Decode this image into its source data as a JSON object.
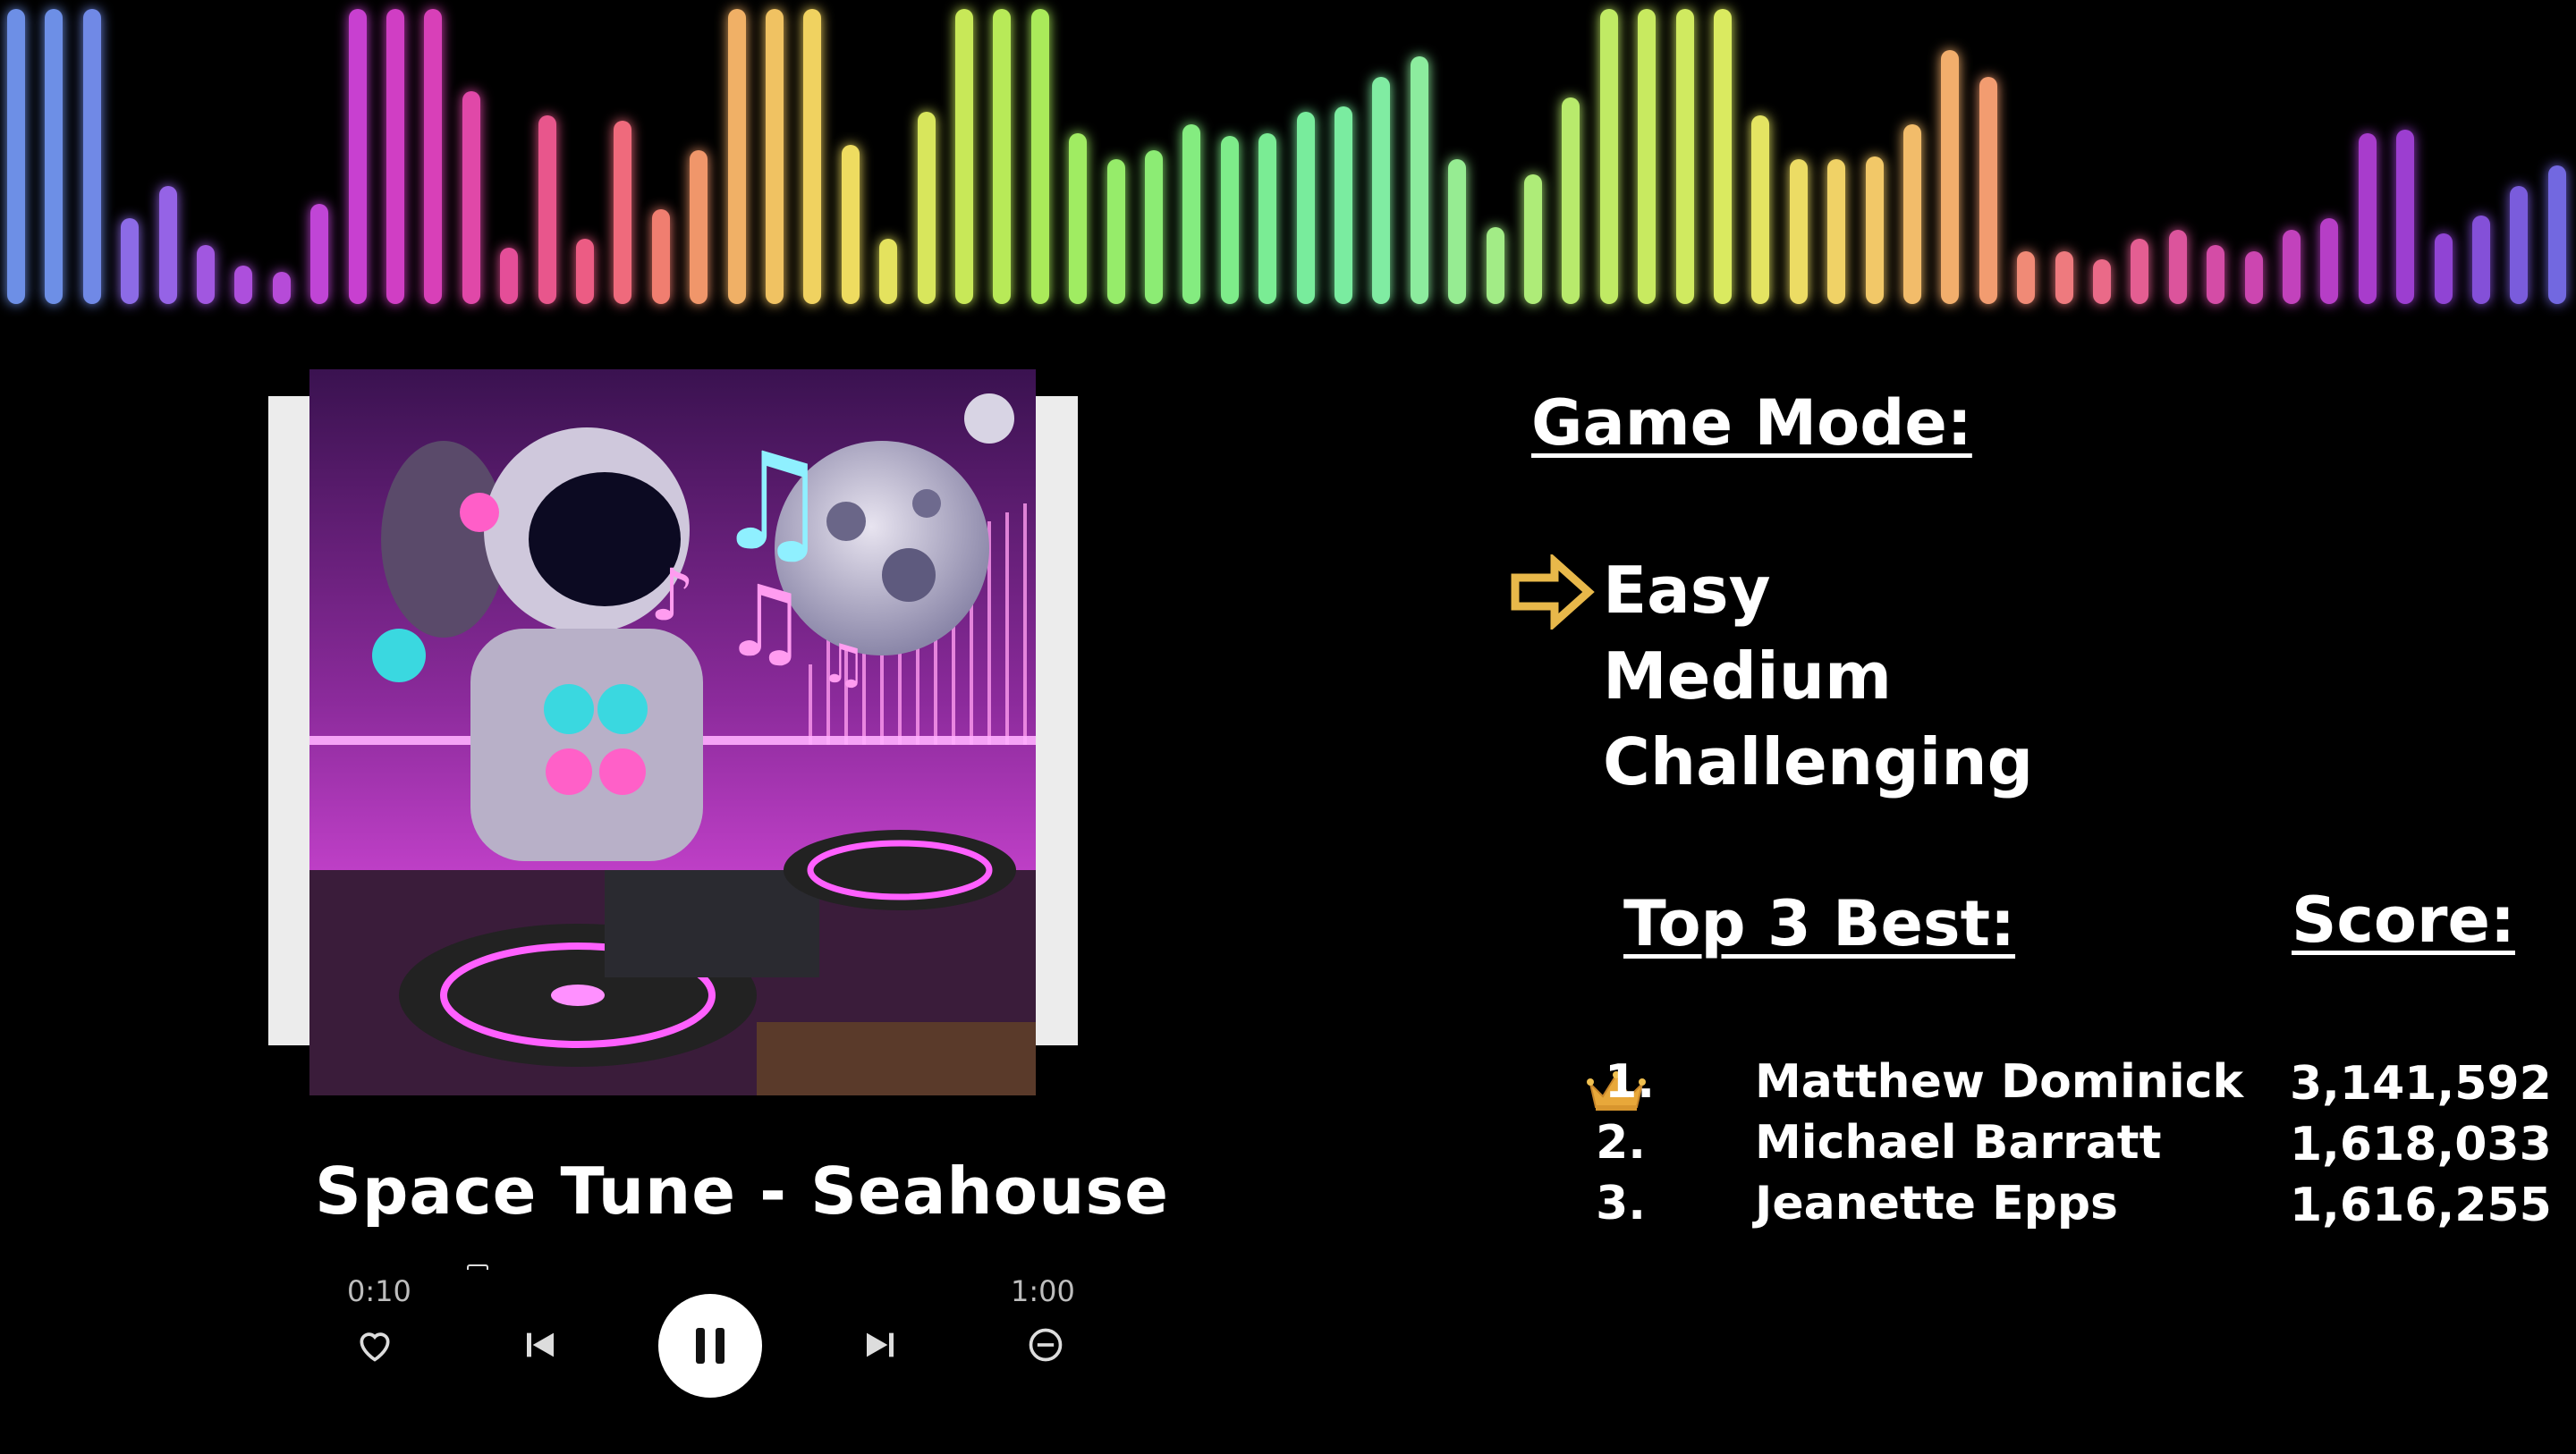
{
  "visualizer": {
    "bars": [
      {
        "level": 1.0,
        "color": "#6d8fe6"
      },
      {
        "level": 1.0,
        "color": "#6d8fe6"
      },
      {
        "level": 1.0,
        "color": "#7089e6"
      },
      {
        "level": 0.29,
        "color": "#8c6be6"
      },
      {
        "level": 0.4,
        "color": "#9563e6"
      },
      {
        "level": 0.2,
        "color": "#a157e0"
      },
      {
        "level": 0.13,
        "color": "#ad4fdc"
      },
      {
        "level": 0.11,
        "color": "#b64bd8"
      },
      {
        "level": 0.34,
        "color": "#c045d6"
      },
      {
        "level": 1.0,
        "color": "#c840d0"
      },
      {
        "level": 1.0,
        "color": "#d03ec4"
      },
      {
        "level": 1.0,
        "color": "#d840b8"
      },
      {
        "level": 0.72,
        "color": "#e048a8"
      },
      {
        "level": 0.19,
        "color": "#e44e98"
      },
      {
        "level": 0.64,
        "color": "#e8568c"
      },
      {
        "level": 0.22,
        "color": "#ec5c84"
      },
      {
        "level": 0.62,
        "color": "#ef6a7c"
      },
      {
        "level": 0.32,
        "color": "#f07e70"
      },
      {
        "level": 0.52,
        "color": "#f0966a"
      },
      {
        "level": 1.0,
        "color": "#f0b066"
      },
      {
        "level": 1.0,
        "color": "#f0c262"
      },
      {
        "level": 1.0,
        "color": "#f0d260"
      },
      {
        "level": 0.54,
        "color": "#eedc60"
      },
      {
        "level": 0.22,
        "color": "#e4e25e"
      },
      {
        "level": 0.65,
        "color": "#d8e65c"
      },
      {
        "level": 1.0,
        "color": "#c8e858"
      },
      {
        "level": 1.0,
        "color": "#b8ea58"
      },
      {
        "level": 1.0,
        "color": "#aaea5a"
      },
      {
        "level": 0.58,
        "color": "#a0ec62"
      },
      {
        "level": 0.49,
        "color": "#96ec6a"
      },
      {
        "level": 0.52,
        "color": "#8cec74"
      },
      {
        "level": 0.61,
        "color": "#84ec80"
      },
      {
        "level": 0.57,
        "color": "#7eec8a"
      },
      {
        "level": 0.58,
        "color": "#7aec94"
      },
      {
        "level": 0.65,
        "color": "#78ec9c"
      },
      {
        "level": 0.67,
        "color": "#7aeca0"
      },
      {
        "level": 0.77,
        "color": "#80eca2"
      },
      {
        "level": 0.84,
        "color": "#8cec9e"
      },
      {
        "level": 0.49,
        "color": "#96ec92"
      },
      {
        "level": 0.26,
        "color": "#a2ec86"
      },
      {
        "level": 0.44,
        "color": "#aeec78"
      },
      {
        "level": 0.7,
        "color": "#b8ea6c"
      },
      {
        "level": 1.0,
        "color": "#c0ea64"
      },
      {
        "level": 1.0,
        "color": "#c8ea60"
      },
      {
        "level": 1.0,
        "color": "#d0ea60"
      },
      {
        "level": 1.0,
        "color": "#daea60"
      },
      {
        "level": 0.64,
        "color": "#e4e462"
      },
      {
        "level": 0.49,
        "color": "#ecdc64"
      },
      {
        "level": 0.49,
        "color": "#f0d266"
      },
      {
        "level": 0.5,
        "color": "#f2c868"
      },
      {
        "level": 0.61,
        "color": "#f2bc6a"
      },
      {
        "level": 0.86,
        "color": "#f2ae6c"
      },
      {
        "level": 0.77,
        "color": "#f29c70"
      },
      {
        "level": 0.18,
        "color": "#f08a76"
      },
      {
        "level": 0.18,
        "color": "#ee7a7e"
      },
      {
        "level": 0.15,
        "color": "#ea6a88"
      },
      {
        "level": 0.22,
        "color": "#e45e92"
      },
      {
        "level": 0.25,
        "color": "#dc549c"
      },
      {
        "level": 0.2,
        "color": "#d44ca6"
      },
      {
        "level": 0.18,
        "color": "#cc46b0"
      },
      {
        "level": 0.25,
        "color": "#c242bc"
      },
      {
        "level": 0.29,
        "color": "#b63ec6"
      },
      {
        "level": 0.58,
        "color": "#a83ccc"
      },
      {
        "level": 0.59,
        "color": "#9c3ed0"
      },
      {
        "level": 0.24,
        "color": "#9044d4"
      },
      {
        "level": 0.3,
        "color": "#8450d8"
      },
      {
        "level": 0.4,
        "color": "#7a5cdc"
      },
      {
        "level": 0.47,
        "color": "#7268e0"
      }
    ]
  },
  "player": {
    "song_title": "Space Tune - Seahouse",
    "time_elapsed": "0:10",
    "time_total": "1:00",
    "controls": [
      "heart-icon",
      "previous-icon",
      "pause-icon",
      "next-icon",
      "minus-circle-icon"
    ]
  },
  "menu": {
    "heading": "Game Mode:",
    "modes": [
      "Easy",
      "Medium",
      "Challenging"
    ],
    "selected_mode": "Easy",
    "arrow_color": "#e8b84a"
  },
  "leaderboard": {
    "heading": "Top 3 Best:",
    "score_heading": "Score:",
    "entries": [
      {
        "rank": "1.",
        "name": "Matthew Dominick",
        "score": "3,141,592"
      },
      {
        "rank": "2.",
        "name": "Michael Barratt",
        "score": "1,618,033"
      },
      {
        "rank": "3.",
        "name": "Jeanette Epps",
        "score": "1,616,255"
      }
    ]
  }
}
